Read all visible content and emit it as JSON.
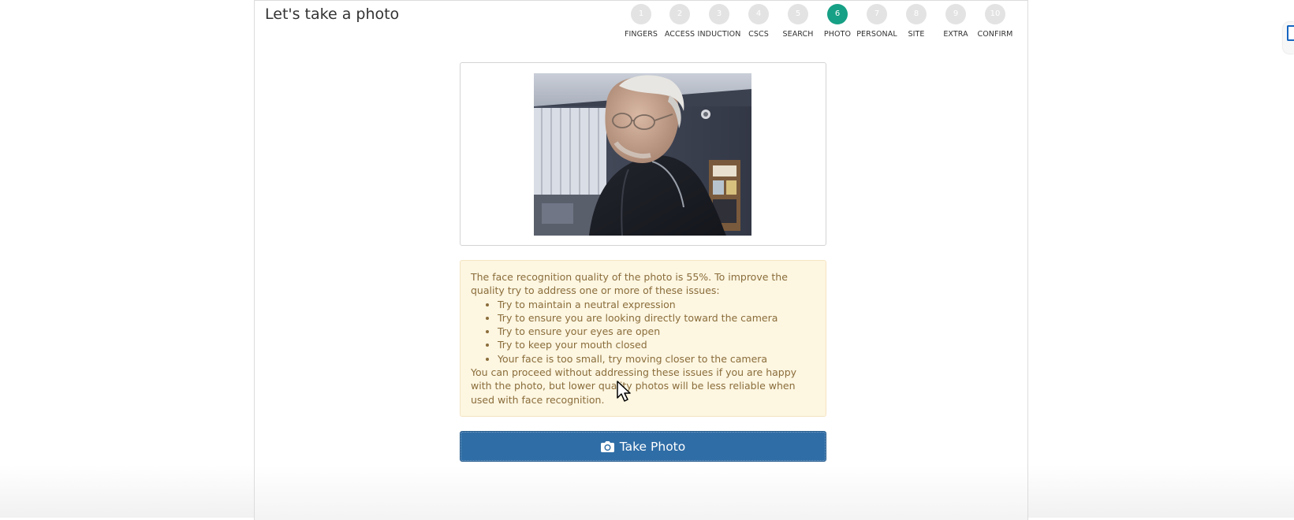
{
  "page_title": "Let's take a photo",
  "steps": [
    {
      "number": "1",
      "label": "FINGERS",
      "active": false
    },
    {
      "number": "2",
      "label": "ACCESS",
      "active": false
    },
    {
      "number": "3",
      "label": "INDUCTION",
      "active": false
    },
    {
      "number": "4",
      "label": "CSCS",
      "active": false
    },
    {
      "number": "5",
      "label": "SEARCH",
      "active": false
    },
    {
      "number": "6",
      "label": "PHOTO",
      "active": true
    },
    {
      "number": "7",
      "label": "PERSONAL",
      "active": false
    },
    {
      "number": "8",
      "label": "SITE",
      "active": false
    },
    {
      "number": "9",
      "label": "EXTRA",
      "active": false
    },
    {
      "number": "10",
      "label": "CONFIRM",
      "active": false
    }
  ],
  "alert": {
    "intro": "The face recognition quality of the photo is 55%. To improve the quality try to address one or more of these issues:",
    "issues": [
      "Try to maintain a neutral expression",
      "Try to ensure you are looking directly toward the camera",
      "Try to ensure your eyes are open",
      "Try to keep your mouth closed",
      "Your face is too small, try moving closer to the camera"
    ],
    "outro": "You can proceed without addressing these issues if you are happy with the photo, but lower quality photos will be less reliable when used with face recognition."
  },
  "take_photo_button": {
    "label": "Take Photo",
    "icon": "camera-icon"
  },
  "colors": {
    "active_step": "#16a085",
    "inactive_step": "#e3e3e3",
    "alert_background": "#fdf6e1",
    "alert_text": "#8a6d3b",
    "primary_button": "#2f6da6"
  }
}
